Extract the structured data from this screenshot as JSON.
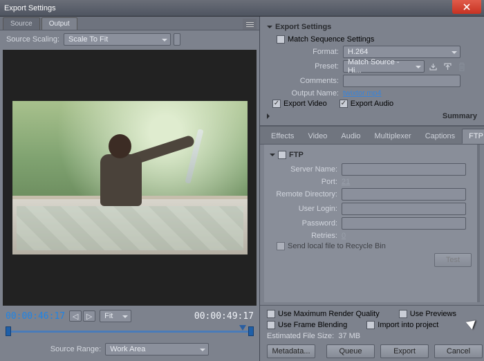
{
  "window": {
    "title": "Export Settings"
  },
  "left": {
    "tabs": {
      "source": "Source",
      "output": "Output"
    },
    "source_scaling_label": "Source Scaling:",
    "source_scaling_value": "Scale To Fit",
    "tc_in": "00:00:46:17",
    "tc_out": "00:00:49:17",
    "fit_label": "Fit",
    "source_range_label": "Source Range:",
    "source_range_value": "Work Area"
  },
  "export": {
    "header": "Export Settings",
    "match_seq": "Match Sequence Settings",
    "format_label": "Format:",
    "format_value": "H.264",
    "preset_label": "Preset:",
    "preset_value": "Match Source - Hi...",
    "comments_label": "Comments:",
    "comments_value": "",
    "output_name_label": "Output Name:",
    "output_name_value": "twixtor.mp4",
    "export_video": "Export Video",
    "export_audio": "Export Audio",
    "summary": "Summary"
  },
  "settings_tabs": {
    "effects": "Effects",
    "video": "Video",
    "audio": "Audio",
    "multiplexer": "Multiplexer",
    "captions": "Captions",
    "ftp": "FTP"
  },
  "ftp": {
    "header": "FTP",
    "server_label": "Server Name:",
    "server_val": "",
    "port_label": "Port:",
    "port_val": "21",
    "remote_label": "Remote Directory:",
    "remote_val": "",
    "user_label": "User Login:",
    "user_val": "",
    "pass_label": "Password:",
    "pass_val": "",
    "retries_label": "Retries:",
    "retries_val": "0",
    "recycle": "Send local file to Recycle Bin",
    "test": "Test"
  },
  "bottom": {
    "max_quality": "Use Maximum Render Quality",
    "previews": "Use Previews",
    "frame_blend": "Use Frame Blending",
    "import_proj": "Import into project",
    "est_label": "Estimated File Size:",
    "est_val": "37 MB",
    "metadata": "Metadata...",
    "queue": "Queue",
    "export": "Export",
    "cancel": "Cancel"
  }
}
